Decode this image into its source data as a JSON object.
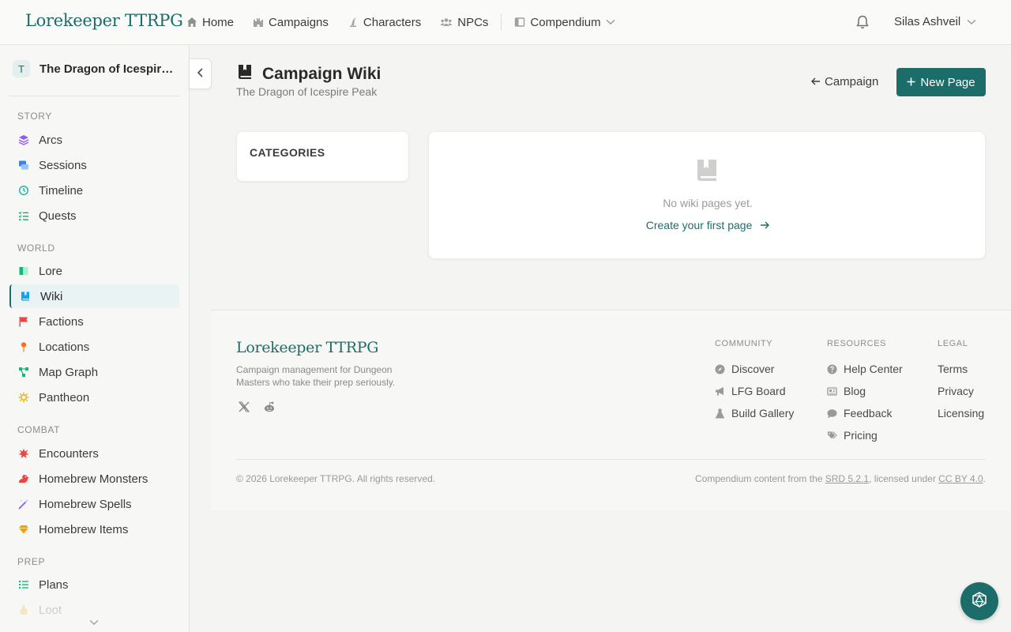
{
  "app": {
    "brand": "Lorekeeper TTRPG"
  },
  "nav": {
    "items": [
      {
        "label": "Home",
        "icon": "home-icon"
      },
      {
        "label": "Campaigns",
        "icon": "castle-icon"
      },
      {
        "label": "Characters",
        "icon": "chess-pawn-icon"
      },
      {
        "label": "NPCs",
        "icon": "users-icon"
      },
      {
        "label": "Compendium",
        "icon": "book-icon"
      }
    ],
    "user_name": "Silas Ashveil"
  },
  "sidebar": {
    "campaign_initial": "T",
    "campaign_name": "The Dragon of Icespire Peak",
    "sections": [
      {
        "label": "STORY",
        "items": [
          {
            "label": "Arcs",
            "icon": "layers-icon",
            "color": "#8b5cf6"
          },
          {
            "label": "Sessions",
            "icon": "scroll-icon",
            "color": "#3b82f6"
          },
          {
            "label": "Timeline",
            "icon": "history-icon",
            "color": "#14b8a6"
          },
          {
            "label": "Quests",
            "icon": "list-check-icon",
            "color": "#10b981"
          }
        ]
      },
      {
        "label": "WORLD",
        "items": [
          {
            "label": "Lore",
            "icon": "book-open-icon",
            "color": "#10b981"
          },
          {
            "label": "Wiki",
            "icon": "book-bookmark-icon",
            "color": "#0ea5e9",
            "active": true
          },
          {
            "label": "Factions",
            "icon": "flag-icon",
            "color": "#ef4444"
          },
          {
            "label": "Locations",
            "icon": "map-pin-icon",
            "color": "#f97316"
          },
          {
            "label": "Map Graph",
            "icon": "graph-icon",
            "color": "#10b981"
          },
          {
            "label": "Pantheon",
            "icon": "sun-icon",
            "color": "#eab308"
          }
        ]
      },
      {
        "label": "COMBAT",
        "items": [
          {
            "label": "Encounters",
            "icon": "burst-icon",
            "color": "#ef4444"
          },
          {
            "label": "Homebrew Monsters",
            "icon": "dragon-icon",
            "color": "#ef4444"
          },
          {
            "label": "Homebrew Spells",
            "icon": "wand-icon",
            "color": "#8b5cf6"
          },
          {
            "label": "Homebrew Items",
            "icon": "gem-icon",
            "color": "#f59e0b"
          }
        ]
      },
      {
        "label": "PREP",
        "items": [
          {
            "label": "Plans",
            "icon": "list-icon",
            "color": "#10b981"
          },
          {
            "label": "Loot",
            "icon": "money-bag-icon",
            "color": "#eab308"
          }
        ]
      }
    ]
  },
  "main": {
    "title": "Campaign Wiki",
    "subtitle": "The Dragon of Icespire Peak",
    "back_label": "Campaign",
    "new_page_label": "New Page",
    "categories_title": "CATEGORIES",
    "empty_text": "No wiki pages yet.",
    "empty_link": "Create your first page"
  },
  "footer": {
    "brand": "Lorekeeper TTRPG",
    "tagline": "Campaign management for Dungeon Masters who take their prep seriously.",
    "community_heading": "COMMUNITY",
    "community": [
      {
        "label": "Discover",
        "icon": "compass-icon"
      },
      {
        "label": "LFG Board",
        "icon": "megaphone-icon"
      },
      {
        "label": "Build Gallery",
        "icon": "flask-icon"
      }
    ],
    "resources_heading": "RESOURCES",
    "resources": [
      {
        "label": "Help Center",
        "icon": "question-icon"
      },
      {
        "label": "Blog",
        "icon": "newspaper-icon"
      },
      {
        "label": "Feedback",
        "icon": "comment-icon"
      },
      {
        "label": "Pricing",
        "icon": "tags-icon"
      }
    ],
    "legal_heading": "LEGAL",
    "legal": [
      {
        "label": "Terms"
      },
      {
        "label": "Privacy"
      },
      {
        "label": "Licensing"
      }
    ],
    "copyright": "© 2026 Lorekeeper TTRPG. All rights reserved.",
    "attrib_prefix": "Compendium content from the ",
    "attrib_srd": "SRD 5.2.1",
    "attrib_mid": ", licensed under ",
    "attrib_license": "CC BY 4.0",
    "attrib_suffix": "."
  }
}
